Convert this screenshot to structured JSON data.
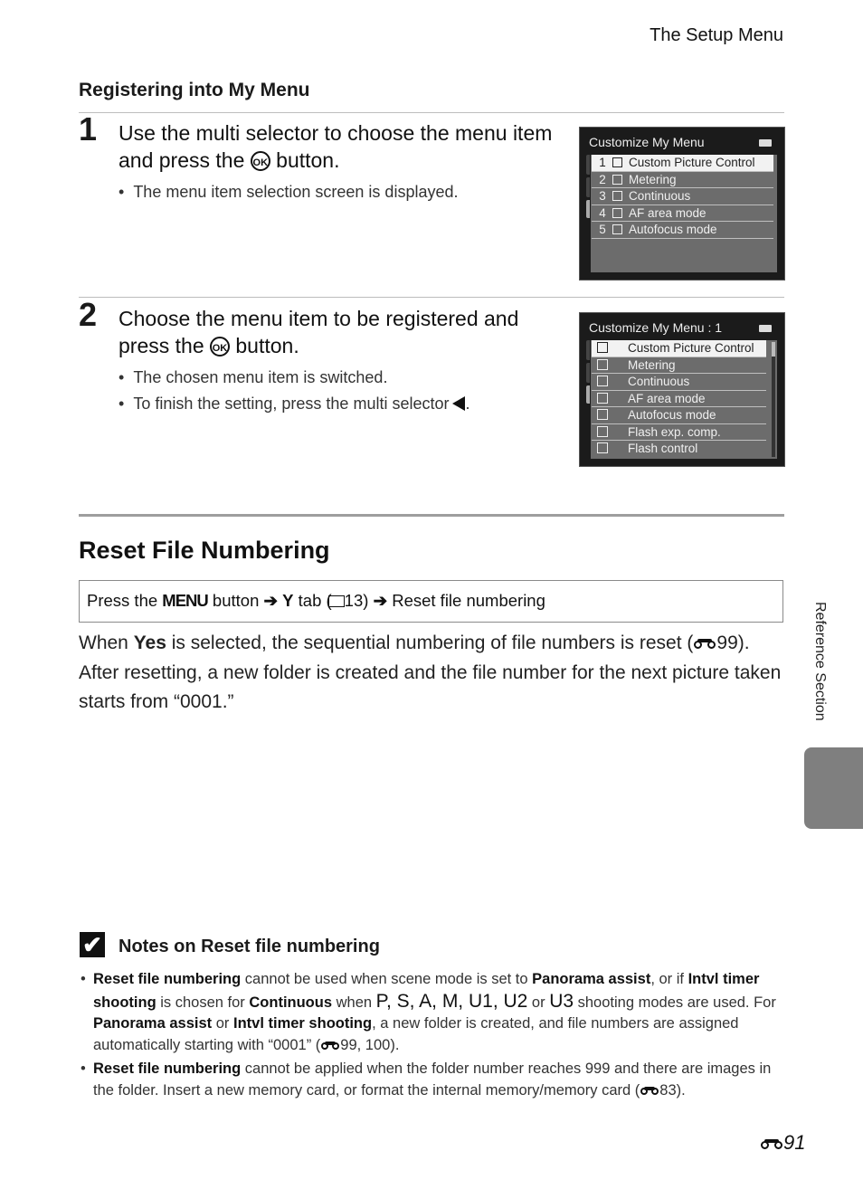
{
  "header": {
    "title": "The Setup Menu"
  },
  "registering": {
    "heading": "Registering into My Menu",
    "steps": [
      {
        "number": "1",
        "text_before": "Use the multi selector to choose the menu item and press the ",
        "ok_label": "OK",
        "text_after": " button.",
        "bullets": [
          "The menu item selection screen is displayed."
        ]
      },
      {
        "number": "2",
        "text_before": "Choose the menu item to be registered and press the ",
        "ok_label": "OK",
        "text_after": " button.",
        "bullets": [
          "The chosen menu item is switched.",
          "To finish the setting, press the multi selector"
        ]
      }
    ],
    "screen1": {
      "title": "Customize My Menu",
      "items": [
        {
          "num": "1",
          "icon": "custom-picture-control-icon",
          "label": "Custom Picture Control"
        },
        {
          "num": "2",
          "icon": "metering-icon",
          "label": "Metering"
        },
        {
          "num": "3",
          "icon": "continuous-icon",
          "label": "Continuous"
        },
        {
          "num": "4",
          "icon": "af-area-mode-icon",
          "label": "AF area mode"
        },
        {
          "num": "5",
          "icon": "autofocus-mode-icon",
          "label": "Autofocus mode"
        }
      ],
      "selected_index": 0
    },
    "screen2": {
      "title": "Customize My Menu : 1",
      "items": [
        {
          "icon": "custom-picture-control-icon",
          "label": "Custom Picture Control"
        },
        {
          "icon": "metering-icon",
          "label": "Metering"
        },
        {
          "icon": "continuous-icon",
          "label": "Continuous"
        },
        {
          "icon": "af-area-mode-icon",
          "label": "AF area mode"
        },
        {
          "icon": "autofocus-mode-icon",
          "label": "Autofocus mode"
        },
        {
          "icon": "flash-exp-comp-icon",
          "label": "Flash exp. comp."
        },
        {
          "icon": "flash-control-icon",
          "label": "Flash control"
        }
      ],
      "selected_index": 0
    }
  },
  "reset": {
    "heading": "Reset File Numbering",
    "path": {
      "press": "Press the",
      "menu": "MENU",
      "button": "button",
      "tab": "tab (",
      "ref": "13)",
      "target": "Reset file numbering"
    },
    "body": {
      "p1_a": "When ",
      "p1_yes": "Yes",
      "p1_b": " is selected, the sequential numbering of file numbers is reset (",
      "p1_ref": "99).",
      "p2": "After resetting, a new folder is created and  the file number for the next picture taken starts from “0001.”"
    },
    "notes": {
      "title": "Notes on Reset file numbering",
      "note1": {
        "b1": "Reset file numbering",
        "t1": " cannot be used when scene mode is set to ",
        "b2": "Panorama assist",
        "t2": ", or if ",
        "b3": "Intvl timer shooting",
        "t3": " is chosen for ",
        "b4": "Continuous",
        "t4": " when ",
        "modes": "P, S, A, M, U1, U2",
        "t5": " or ",
        "mode_last": "U3",
        "t6": " shooting modes are used. For ",
        "b5": "Panorama assist",
        "t7": " or ",
        "b6": "Intvl timer shooting",
        "t8": ", a new folder is created, and file numbers are assigned automatically starting with “0001” (",
        "ref": "99, 100)."
      },
      "note2": {
        "b1": "Reset file numbering",
        "t1": " cannot be applied when the folder number reaches 999 and there are images in the folder. Insert a new memory card, or format the internal memory/memory card (",
        "ref": "83)."
      }
    }
  },
  "side": {
    "label": "Reference Section"
  },
  "footer": {
    "page": "91"
  }
}
